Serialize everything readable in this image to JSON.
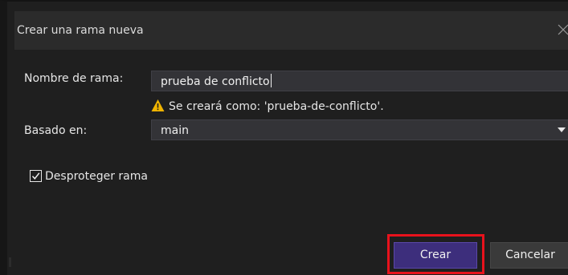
{
  "dialog": {
    "title": "Crear una rama nueva"
  },
  "form": {
    "branch_name_label": "Nombre de rama:",
    "branch_name_value": "prueba de conflicto",
    "warning_text": "Se creará como: 'prueba-de-conflicto'.",
    "based_on_label": "Basado en:",
    "based_on_value": "main",
    "unprotect_label": "Desproteger rama",
    "unprotect_checked": true
  },
  "buttons": {
    "create_label": "Crear",
    "cancel_label": "Cancelar"
  },
  "icons": {
    "close": "close-icon",
    "warning": "warning-icon",
    "dropdown": "chevron-down-icon",
    "check": "checkmark-icon"
  },
  "colors": {
    "primary_button": "#3d2e7c",
    "highlight": "#e8121c",
    "warning": "#f0b400"
  }
}
